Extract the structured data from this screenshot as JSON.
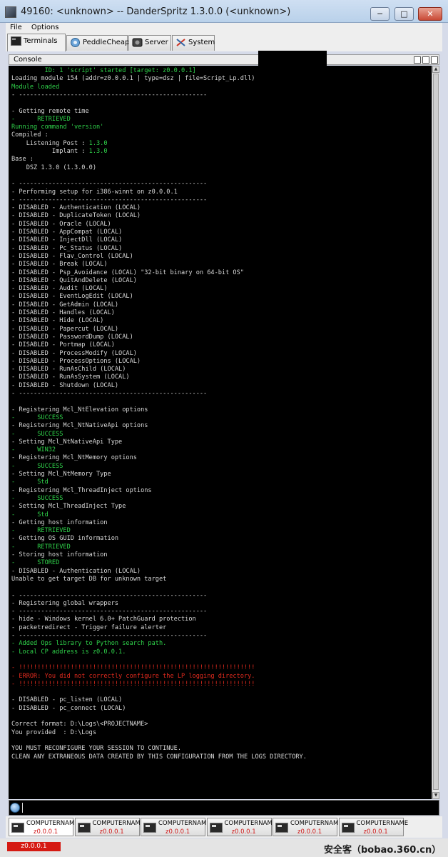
{
  "window": {
    "title": "49160: <unknown> -- DanderSpritz 1.3.0.0 (<unknown>)",
    "min_label": "─",
    "max_label": "□",
    "close_label": "✕"
  },
  "menu": {
    "items": [
      "File",
      "Options"
    ]
  },
  "tabs": [
    {
      "label": "Terminals",
      "icon": "terminal-icon",
      "active": true
    },
    {
      "label": "PeddleCheap",
      "icon": "peddlecheap-icon",
      "active": false
    },
    {
      "label": "Server",
      "icon": "server-icon",
      "active": false
    },
    {
      "label": "System",
      "icon": "system-icon",
      "active": false
    }
  ],
  "console": {
    "label": "Console",
    "lines": [
      {
        "t": "         ID: 1 'script' started [target: z0.0.0.1]",
        "c": "g"
      },
      {
        "t": "Loading module 154 (addr=z0.0.0.1 | type=dsz | file=Script_Lp.dll)",
        "c": "w"
      },
      {
        "t": "Module loaded",
        "c": "g"
      },
      {
        "t": "- ---------------------------------------------------",
        "c": "w"
      },
      {
        "t": "",
        "c": "w"
      },
      {
        "t": "- Getting remote time",
        "c": "w"
      },
      {
        "t": "-      RETRIEVED",
        "c": "g"
      },
      {
        "t": "Running command 'version'",
        "c": "g"
      },
      {
        "t": "Compiled :",
        "c": "w"
      },
      {
        "t": "    Listening Post : 1.3.0",
        "c": "w",
        "v": "1.3.0"
      },
      {
        "t": "           Implant : 1.3.0",
        "c": "w",
        "v": "1.3.0"
      },
      {
        "t": "Base :",
        "c": "w"
      },
      {
        "t": "    DSZ 1.3.0 (1.3.0.0)",
        "c": "w"
      },
      {
        "t": "",
        "c": "w"
      },
      {
        "t": "- ---------------------------------------------------",
        "c": "w"
      },
      {
        "t": "- Performing setup for i386-winnt on z0.0.0.1",
        "c": "w"
      },
      {
        "t": "- ---------------------------------------------------",
        "c": "w"
      },
      {
        "t": "- DISABLED - Authentication (LOCAL)",
        "c": "w"
      },
      {
        "t": "- DISABLED - DuplicateToken (LOCAL)",
        "c": "w"
      },
      {
        "t": "- DISABLED - Oracle (LOCAL)",
        "c": "w"
      },
      {
        "t": "- DISABLED - AppCompat (LOCAL)",
        "c": "w"
      },
      {
        "t": "- DISABLED - InjectDll (LOCAL)",
        "c": "w"
      },
      {
        "t": "- DISABLED - Pc_Status (LOCAL)",
        "c": "w"
      },
      {
        "t": "- DISABLED - Flav_Control (LOCAL)",
        "c": "w"
      },
      {
        "t": "- DISABLED - Break (LOCAL)",
        "c": "w"
      },
      {
        "t": "- DISABLED - Psp_Avoidance (LOCAL) \"32-bit binary on 64-bit OS\"",
        "c": "w"
      },
      {
        "t": "- DISABLED - QuitAndDelete (LOCAL)",
        "c": "w"
      },
      {
        "t": "- DISABLED - Audit (LOCAL)",
        "c": "w"
      },
      {
        "t": "- DISABLED - EventLogEdit (LOCAL)",
        "c": "w"
      },
      {
        "t": "- DISABLED - GetAdmin (LOCAL)",
        "c": "w"
      },
      {
        "t": "- DISABLED - Handles (LOCAL)",
        "c": "w"
      },
      {
        "t": "- DISABLED - Hide (LOCAL)",
        "c": "w"
      },
      {
        "t": "- DISABLED - Papercut (LOCAL)",
        "c": "w"
      },
      {
        "t": "- DISABLED - PasswordDump (LOCAL)",
        "c": "w"
      },
      {
        "t": "- DISABLED - Portmap (LOCAL)",
        "c": "w"
      },
      {
        "t": "- DISABLED - ProcessModify (LOCAL)",
        "c": "w"
      },
      {
        "t": "- DISABLED - ProcessOptions (LOCAL)",
        "c": "w"
      },
      {
        "t": "- DISABLED - RunAsChild (LOCAL)",
        "c": "w"
      },
      {
        "t": "- DISABLED - RunAsSystem (LOCAL)",
        "c": "w"
      },
      {
        "t": "- DISABLED - Shutdown (LOCAL)",
        "c": "w"
      },
      {
        "t": "- ---------------------------------------------------",
        "c": "w"
      },
      {
        "t": "",
        "c": "w"
      },
      {
        "t": "- Registering Mcl_NtElevation options",
        "c": "w"
      },
      {
        "t": "-      SUCCESS",
        "c": "g"
      },
      {
        "t": "- Registering Mcl_NtNativeApi options",
        "c": "w"
      },
      {
        "t": "-      SUCCESS",
        "c": "g"
      },
      {
        "t": "- Setting Mcl_NtNativeApi Type",
        "c": "w"
      },
      {
        "t": "-      WIN32",
        "c": "g"
      },
      {
        "t": "- Registering Mcl_NtMemory options",
        "c": "w"
      },
      {
        "t": "-      SUCCESS",
        "c": "g"
      },
      {
        "t": "- Setting Mcl_NtMemory Type",
        "c": "w"
      },
      {
        "t": "-      Std",
        "c": "g"
      },
      {
        "t": "- Registering Mcl_ThreadInject options",
        "c": "w"
      },
      {
        "t": "-      SUCCESS",
        "c": "g"
      },
      {
        "t": "- Setting Mcl_ThreadInject Type",
        "c": "w"
      },
      {
        "t": "-      Std",
        "c": "g"
      },
      {
        "t": "- Getting host information",
        "c": "w"
      },
      {
        "t": "-      RETRIEVED",
        "c": "g"
      },
      {
        "t": "- Getting OS GUID information",
        "c": "w"
      },
      {
        "t": "-      RETRIEVED",
        "c": "g"
      },
      {
        "t": "- Storing host information",
        "c": "w"
      },
      {
        "t": "-      STORED",
        "c": "g"
      },
      {
        "t": "- DISABLED - Authentication (LOCAL)",
        "c": "w"
      },
      {
        "t": "Unable to get target DB for unknown target",
        "c": "w"
      },
      {
        "t": "",
        "c": "w"
      },
      {
        "t": "- ---------------------------------------------------",
        "c": "w"
      },
      {
        "t": "- Registering global wrappers",
        "c": "w"
      },
      {
        "t": "- ---------------------------------------------------",
        "c": "w"
      },
      {
        "t": "- hide - Windows kernel 6.0+ PatchGuard protection",
        "c": "w"
      },
      {
        "t": "- packetredirect - Trigger failure alerter",
        "c": "w"
      },
      {
        "t": "- ---------------------------------------------------",
        "c": "w"
      },
      {
        "t": "- Added Ops library to Python search path.",
        "c": "g"
      },
      {
        "t": "- Local CP address is z0.0.0.1.",
        "c": "g"
      },
      {
        "t": "",
        "c": "w"
      },
      {
        "t": "- !!!!!!!!!!!!!!!!!!!!!!!!!!!!!!!!!!!!!!!!!!!!!!!!!!!!!!!!!!!!!!!!",
        "c": "r"
      },
      {
        "t": "- ERROR: You did not correctly configure the LP logging directory.",
        "c": "r"
      },
      {
        "t": "- !!!!!!!!!!!!!!!!!!!!!!!!!!!!!!!!!!!!!!!!!!!!!!!!!!!!!!!!!!!!!!!!",
        "c": "r"
      },
      {
        "t": "",
        "c": "w"
      },
      {
        "t": "- DISABLED - pc_listen (LOCAL)",
        "c": "w"
      },
      {
        "t": "- DISABLED - pc_connect (LOCAL)",
        "c": "w"
      },
      {
        "t": "",
        "c": "w"
      },
      {
        "t": "Correct format: D:\\Logs\\<PROJECTNAME>",
        "c": "w"
      },
      {
        "t": "You provided  : D:\\Logs",
        "c": "w"
      },
      {
        "t": "",
        "c": "w"
      },
      {
        "t": "YOU MUST RECONFIGURE YOUR SESSION TO CONTINUE.",
        "c": "w"
      },
      {
        "t": "CLEAN ANY EXTRANEOUS DATA CREATED BY THIS CONFIGURATION FROM THE LOGS DIRECTORY.",
        "c": "w"
      }
    ]
  },
  "sessions": [
    {
      "name": "COMPUTERNAME",
      "addr": "z0.0.0.1",
      "active": true
    },
    {
      "name": "COMPUTERNAME",
      "addr": "z0.0.0.1",
      "active": false
    },
    {
      "name": "COMPUTERNAME",
      "addr": "z0.0.0.1",
      "active": false
    },
    {
      "name": "COMPUTERNAME",
      "addr": "z0.0.0.1",
      "active": false
    },
    {
      "name": "COMPUTERNAME",
      "addr": "z0.0.0.1",
      "active": false
    },
    {
      "name": "COMPUTERNAME",
      "addr": "z0.0.0.1",
      "active": false
    }
  ],
  "status": {
    "target": "z0.0.0.1",
    "watermark": "安全客（bobao.360.cn）"
  },
  "colors": {
    "green": "#2fd24a",
    "red": "#e02a1e",
    "white": "#d8d8d8",
    "status_red": "#d51a12"
  }
}
